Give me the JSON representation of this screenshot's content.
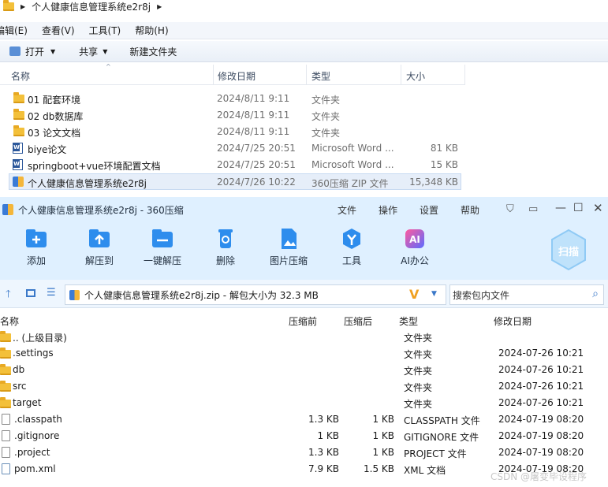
{
  "explorer": {
    "breadcrumb": "个人健康信息管理系统e2r8j",
    "menu": [
      "编辑(E)",
      "查看(V)",
      "工具(T)",
      "帮助(H)"
    ],
    "toolbar": {
      "open": "打开",
      "share": "共享",
      "new_folder": "新建文件夹"
    },
    "columns": {
      "name": "名称",
      "date": "修改日期",
      "type": "类型",
      "size": "大小"
    },
    "files": [
      {
        "icon": "folder-icon",
        "name": "01 配套环境",
        "date": "2024/8/11 9:11",
        "type": "文件夹",
        "size": ""
      },
      {
        "icon": "folder-icon",
        "name": "02 db数据库",
        "date": "2024/8/11 9:11",
        "type": "文件夹",
        "size": ""
      },
      {
        "icon": "folder-icon",
        "name": "03 论文文档",
        "date": "2024/8/11 9:11",
        "type": "文件夹",
        "size": ""
      },
      {
        "icon": "word-doc-icon",
        "name": "biye论文",
        "date": "2024/7/25 20:51",
        "type": "Microsoft Word ...",
        "size": "81 KB"
      },
      {
        "icon": "word-doc-icon",
        "name": "springboot+vue环境配置文档",
        "date": "2024/7/25 20:51",
        "type": "Microsoft Word ...",
        "size": "15 KB"
      },
      {
        "icon": "zip-icon",
        "name": "个人健康信息管理系统e2r8j",
        "date": "2024/7/26 10:22",
        "type": "360压缩 ZIP 文件",
        "size": "15,348 KB"
      }
    ]
  },
  "zip": {
    "title": "个人健康信息管理系统e2r8j - 360压缩",
    "menu": [
      "文件",
      "操作",
      "设置",
      "帮助"
    ],
    "tools": [
      "添加",
      "解压到",
      "一键解压",
      "删除",
      "图片压缩",
      "工具",
      "AI办公"
    ],
    "scan": "扫描",
    "path": "个人健康信息管理系统e2r8j.zip - 解包大小为 32.3 MB",
    "search_placeholder": "搜索包内文件",
    "columns": {
      "name": "名称",
      "compressed": "压缩前",
      "after": "压缩后",
      "type": "类型",
      "date": "修改日期"
    },
    "entries": [
      {
        "icon": "folder-icon",
        "name": ".. (上级目录)",
        "before": "",
        "after": "",
        "type": "文件夹",
        "date": ""
      },
      {
        "icon": "folder-icon",
        "name": ".settings",
        "before": "",
        "after": "",
        "type": "文件夹",
        "date": "2024-07-26 10:21"
      },
      {
        "icon": "folder-icon",
        "name": "db",
        "before": "",
        "after": "",
        "type": "文件夹",
        "date": "2024-07-26 10:21"
      },
      {
        "icon": "folder-icon",
        "name": "src",
        "before": "",
        "after": "",
        "type": "文件夹",
        "date": "2024-07-26 10:21"
      },
      {
        "icon": "folder-icon",
        "name": "target",
        "before": "",
        "after": "",
        "type": "文件夹",
        "date": "2024-07-26 10:21"
      },
      {
        "icon": "file-icon",
        "name": ".classpath",
        "before": "1.3 KB",
        "after": "1 KB",
        "type": "CLASSPATH 文件",
        "date": "2024-07-19 08:20"
      },
      {
        "icon": "file-icon",
        "name": ".gitignore",
        "before": "1 KB",
        "after": "1 KB",
        "type": "GITIGNORE 文件",
        "date": "2024-07-19 08:20"
      },
      {
        "icon": "file-icon",
        "name": ".project",
        "before": "1.3 KB",
        "after": "1 KB",
        "type": "PROJECT 文件",
        "date": "2024-07-19 08:20"
      },
      {
        "icon": "xml-file-icon",
        "name": "pom.xml",
        "before": "7.9 KB",
        "after": "1.5 KB",
        "type": "XML 文档",
        "date": "2024-07-19 08:20"
      }
    ]
  },
  "watermark": "CSDN @屠变毕设程序"
}
